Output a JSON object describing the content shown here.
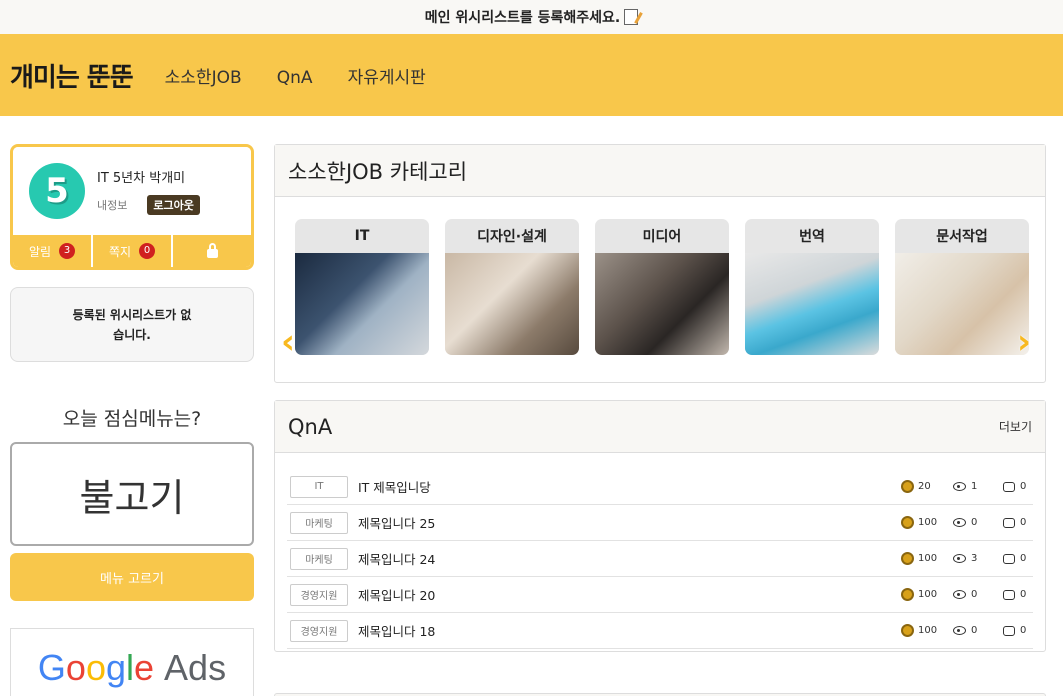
{
  "topbar": {
    "text": "메인 위시리스트를 등록해주세요."
  },
  "header": {
    "logo": "개미는 뚠뚠",
    "nav": [
      "소소한JOB",
      "QnA",
      "자유게시판"
    ]
  },
  "profile": {
    "level": "5",
    "name": "IT 5년차 박개미",
    "myinfo": "내정보",
    "logout": "로그아웃",
    "alarm_label": "알림",
    "alarm_count": "3",
    "message_label": "쪽지",
    "message_count": "0"
  },
  "wishlist": {
    "empty_text": "등록된 위시리스트가 없습니다."
  },
  "lunch": {
    "title": "오늘 점심메뉴는?",
    "menu": "불고기",
    "button": "메뉴 고르기"
  },
  "ad": {
    "brand": "Google",
    "suffix": "Ads"
  },
  "categories_panel": {
    "title": "소소한JOB 카테고리",
    "items": [
      "IT",
      "디자인·설계",
      "미디어",
      "번역",
      "문서작업"
    ]
  },
  "qna_panel": {
    "title": "QnA",
    "more": "더보기",
    "rows": [
      {
        "tag": "IT",
        "title": "IT 제목입니당",
        "coins": "20",
        "views": "1",
        "comments": "0"
      },
      {
        "tag": "마케팅",
        "title": "제목입니다 25",
        "coins": "100",
        "views": "0",
        "comments": "0"
      },
      {
        "tag": "마케팅",
        "title": "제목입니다 24",
        "coins": "100",
        "views": "3",
        "comments": "0"
      },
      {
        "tag": "경영지원",
        "title": "제목입니다 20",
        "coins": "100",
        "views": "0",
        "comments": "0"
      },
      {
        "tag": "경영지원",
        "title": "제목입니다 18",
        "coins": "100",
        "views": "0",
        "comments": "0"
      }
    ]
  },
  "colors": {
    "brand_yellow": "#f8c74b",
    "badge_red": "#d0201f",
    "level_teal": "#27c9b0"
  }
}
